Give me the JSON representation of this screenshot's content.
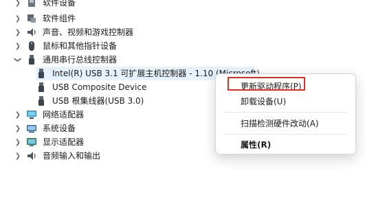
{
  "tree": {
    "rows": [
      {
        "label": "软件设备",
        "expanded": false,
        "icon": "software-device-icon"
      },
      {
        "label": "软件组件",
        "expanded": false,
        "icon": "software-component-icon"
      },
      {
        "label": "声音、视频和游戏控制器",
        "expanded": false,
        "icon": "speaker-icon"
      },
      {
        "label": "鼠标和其他指针设备",
        "expanded": false,
        "icon": "mouse-icon"
      },
      {
        "label": "通用串行总线控制器",
        "expanded": true,
        "icon": "usb-icon"
      },
      {
        "label": "Intel(R) USB 3.1 可扩展主机控制器 - 1.10 (Microsoft)",
        "icon": "usb-plug-icon",
        "selected": true
      },
      {
        "label": "USB Composite Device",
        "icon": "usb-plug-icon"
      },
      {
        "label": "USB 根集线器(USB 3.0)",
        "icon": "usb-plug-icon"
      },
      {
        "label": "网络适配器",
        "expanded": false,
        "icon": "network-icon"
      },
      {
        "label": "系统设备",
        "expanded": false,
        "icon": "system-icon"
      },
      {
        "label": "显示适配器",
        "expanded": false,
        "icon": "display-icon"
      },
      {
        "label": "音频输入和输出",
        "expanded": false,
        "icon": "audio-icon"
      }
    ]
  },
  "context_menu": {
    "items": [
      {
        "label": "更新驱动程序(P)",
        "highlighted": true
      },
      {
        "label": "卸载设备(U)"
      },
      {
        "label": "扫描检测硬件改动(A)"
      },
      {
        "label": "属性(R)",
        "bold": true
      }
    ],
    "highlight_color": "#d93025"
  },
  "colors": {
    "selection": "#e5f1fb",
    "text": "#1a1a1a"
  }
}
